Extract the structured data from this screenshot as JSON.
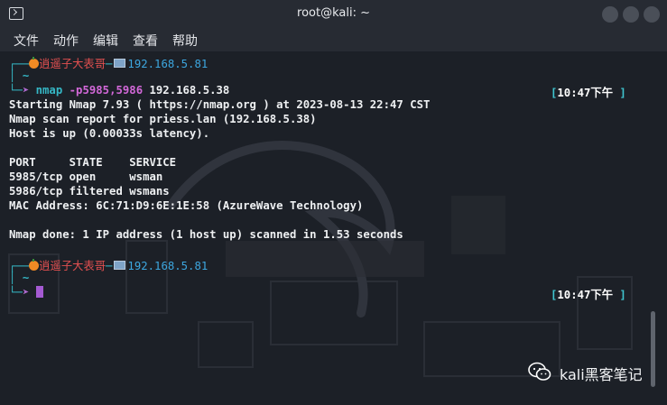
{
  "window": {
    "title": "root@kali: ~"
  },
  "menu": [
    "文件",
    "动作",
    "编辑",
    "查看",
    "帮助"
  ],
  "prompt": {
    "user_host": "逍遥子大表哥",
    "ip": "192.168.5.81",
    "cwd": "~"
  },
  "session": {
    "command_name": "nmap",
    "command_args": "-p5985,5986",
    "command_target": "192.168.5.38",
    "time": "10:47下午",
    "output": [
      "Starting Nmap 7.93 ( https://nmap.org ) at 2023-08-13 22:47 CST",
      "Nmap scan report for priess.lan (192.168.5.38)",
      "Host is up (0.00033s latency).",
      "",
      "PORT     STATE    SERVICE",
      "5985/tcp open     wsman",
      "5986/tcp filtered wsmans",
      "MAC Address: 6C:71:D9:6E:1E:58 (AzureWave Technology)",
      "",
      "Nmap done: 1 IP address (1 host up) scanned in 1.53 seconds"
    ]
  },
  "prompt2": {
    "user_host": "逍遥子大表哥",
    "ip": "192.168.5.81",
    "cwd": "~",
    "time": "10:47下午"
  },
  "watermark": {
    "text": "kali黑客笔记"
  },
  "colors": {
    "prompt_teal": "#35b7c5",
    "arrow_purple": "#b06ad0",
    "user_red": "#e35050",
    "ip_blue": "#3da7e0"
  }
}
